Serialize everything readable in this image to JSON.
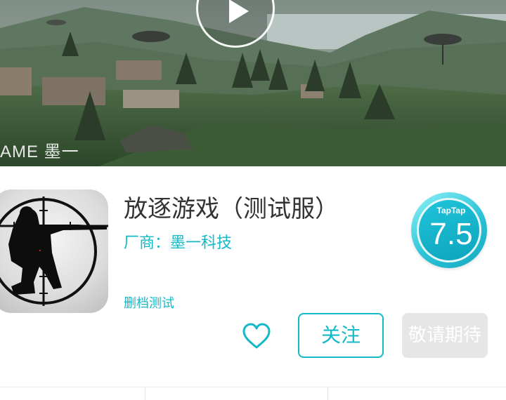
{
  "hero": {
    "watermark": "AME 墨一",
    "play_icon": "play-icon"
  },
  "app": {
    "title": "放逐游戏（测试服）",
    "vendor": "厂商：墨一科技",
    "status_tag": "删档测试",
    "icon": "sniper-soldier-app-icon"
  },
  "rating": {
    "brand": "TapTap",
    "score": "7.5"
  },
  "actions": {
    "favorite_icon": "heart-icon",
    "follow_label": "关注",
    "expect_label": "敬请期待"
  },
  "colors": {
    "accent": "#14b9c8",
    "title_text": "#333333",
    "disabled_button": "#e6e6e6"
  }
}
